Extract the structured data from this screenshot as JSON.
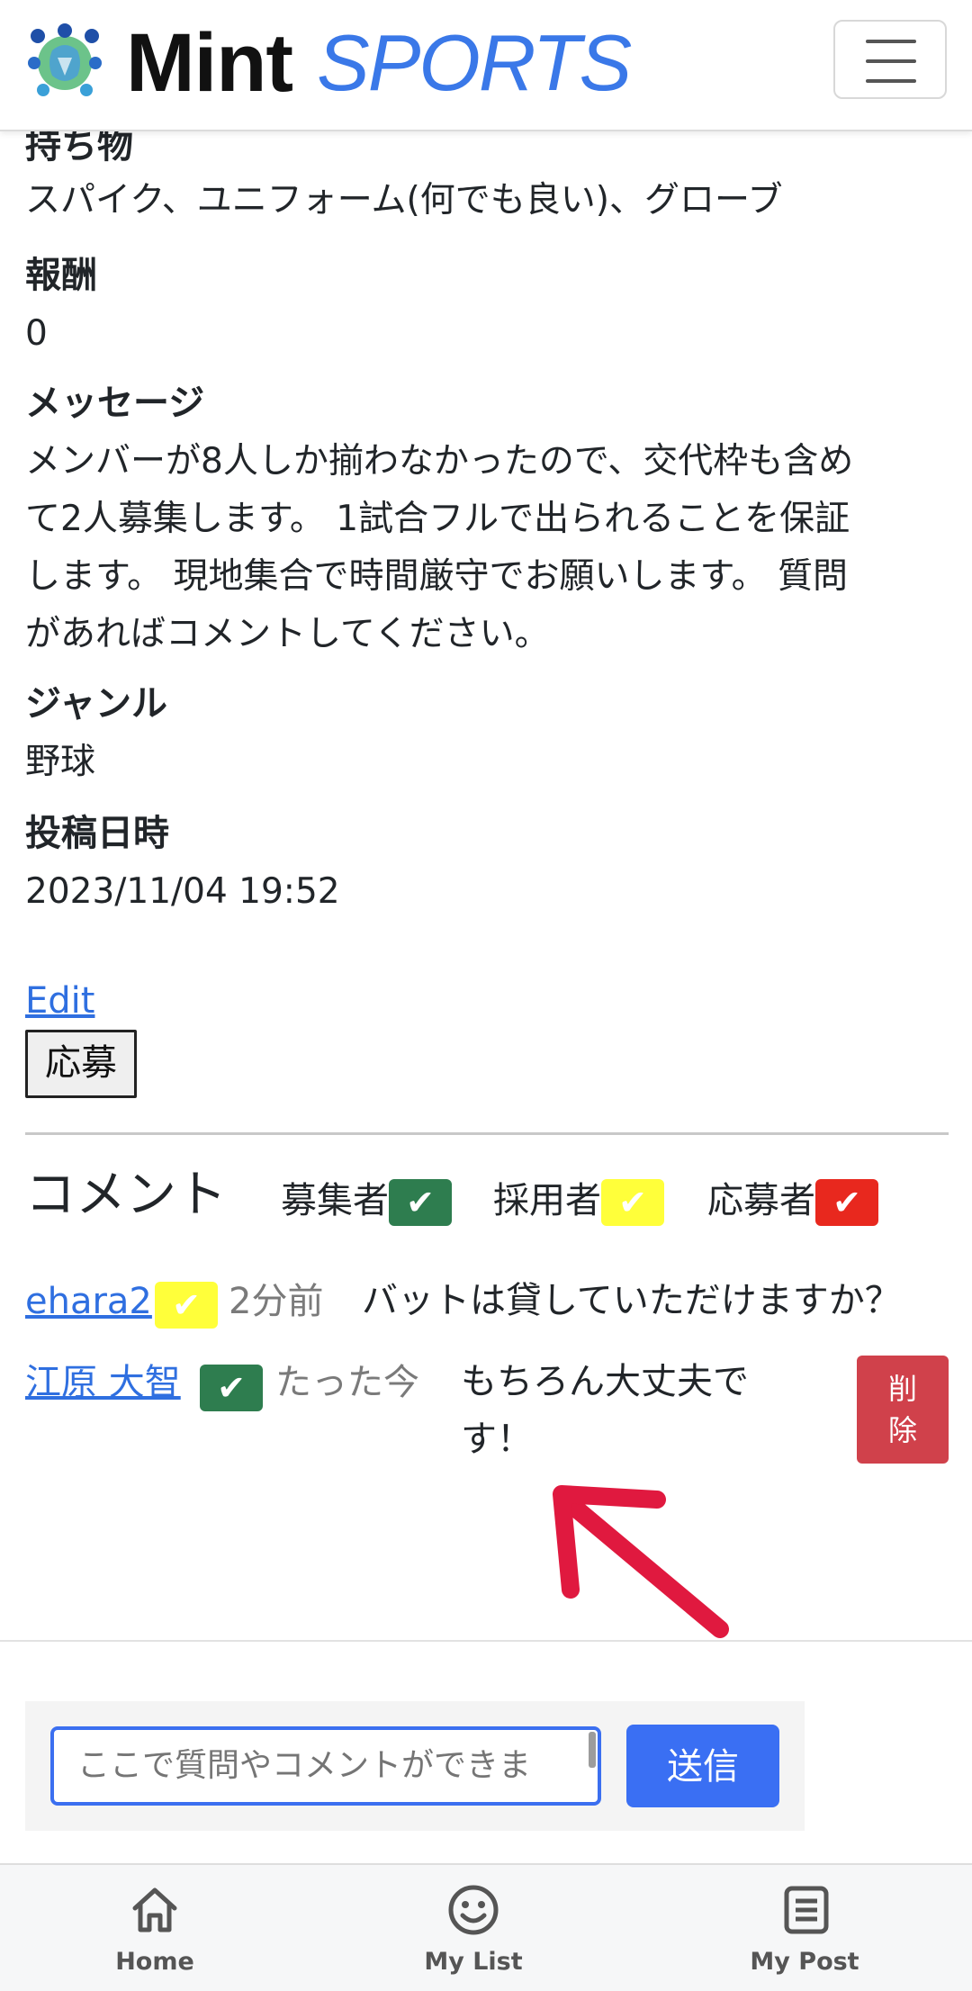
{
  "header": {
    "brand_main": "Mint",
    "brand_accent": "SPORTS",
    "accent_color": "#3a78e8",
    "menu_icon": "hamburger-icon"
  },
  "details": {
    "items_label": "持ち物",
    "items_value": "スパイク、ユニフォーム(何でも良い)、グローブ",
    "reward_label": "報酬",
    "reward_value": "0",
    "message_label": "メッセージ",
    "message_lines": [
      "メンバーが8人しか揃わなかったので、交代枠も含め",
      "て2人募集します。 1試合フルで出られることを保証",
      "します。 現地集合で時間厳守でお願いします。 質問",
      "があればコメントしてください。"
    ],
    "genre_label": "ジャンル",
    "genre_value": "野球",
    "posted_label": "投稿日時",
    "posted_value": "2023/11/04 19:52"
  },
  "actions": {
    "edit_label": "Edit",
    "apply_label": "応募"
  },
  "comments": {
    "title": "コメント",
    "legend": [
      {
        "label": "募集者",
        "color": "#2e7d4f"
      },
      {
        "label": "採用者",
        "color": "#ffff3a"
      },
      {
        "label": "応募者",
        "color": "#e8281e"
      }
    ],
    "check_glyph": "✔",
    "list": [
      {
        "user": "ehara2",
        "role": "採用者",
        "time": "2分前",
        "text": "バットは貸していただけますか？"
      },
      {
        "user": "江原 大智",
        "role": "募集者",
        "time": "たった今",
        "text_lines": [
          "もちろん大丈夫で",
          "す！"
        ],
        "delete_lines": [
          "削",
          "除"
        ]
      }
    ],
    "input_placeholder": "ここで質問やコメントができま",
    "send_label": "送信"
  },
  "nav": [
    {
      "label": "Home",
      "icon": "home-icon"
    },
    {
      "label": "My List",
      "icon": "smiley-icon"
    },
    {
      "label": "My Post",
      "icon": "document-icon"
    }
  ]
}
